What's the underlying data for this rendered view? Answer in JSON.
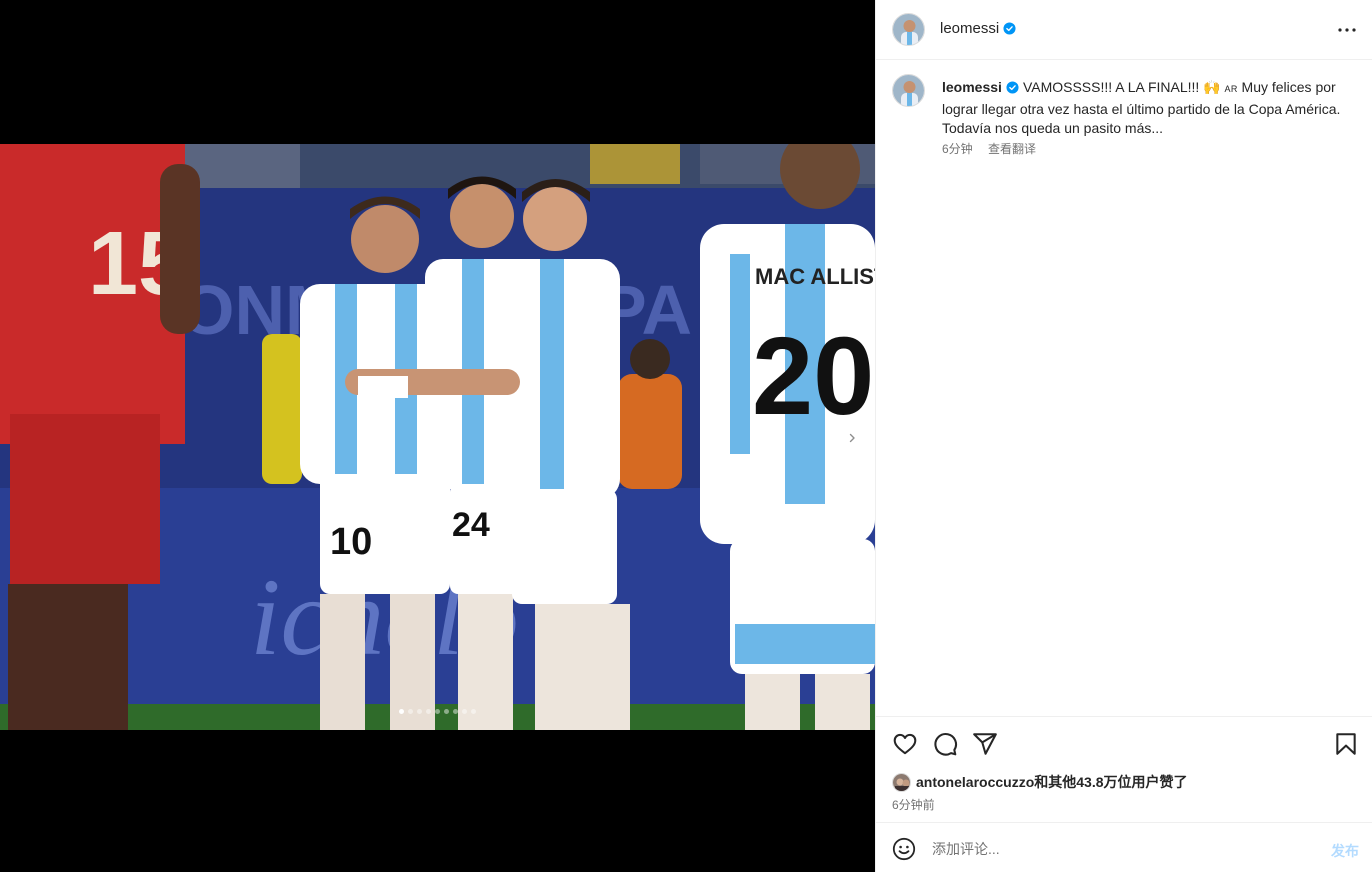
{
  "post": {
    "username": "leomessi",
    "verified": true,
    "image_alt": "Argentina players celebrating together during a Copa América match",
    "carousel": {
      "total": 9,
      "active": 1
    }
  },
  "caption": {
    "username": "leomessi",
    "text_start": "VAMOSSSS!!! A LA FINAL!!! 🙌",
    "flag": "AR",
    "text_end": " Muy felices por lograr llegar otra vez hasta el último partido de la Copa América. Todavía nos queda un pasito más...",
    "time": "6分钟",
    "see_translation": "查看翻译"
  },
  "engagement": {
    "likes_text": "antonelaroccuzzo和其他43.8万位用户赞了",
    "time_ago": "6分钟前"
  },
  "comment": {
    "placeholder": "添加评论...",
    "post_label": "发布"
  },
  "colors": {
    "verified": "#0095f6",
    "post_button_disabled": "#b3dbff",
    "secondary_text": "#737373",
    "divider": "#efefef"
  },
  "icons": {
    "more": "more-horizontal-icon",
    "like": "heart-icon",
    "comment": "comment-bubble-icon",
    "share": "paper-plane-icon",
    "save": "bookmark-icon",
    "emoji": "smiley-icon",
    "next": "chevron-right-icon"
  }
}
